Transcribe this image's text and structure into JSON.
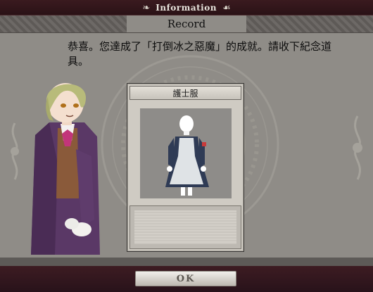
{
  "window": {
    "title": "Information",
    "subtitle": "Record"
  },
  "message": {
    "text": "恭喜。您達成了「打倒冰之惡魔」的成就。請收下紀念道具。"
  },
  "item_card": {
    "name": "護士服"
  },
  "buttons": {
    "ok_label": "OK"
  },
  "icons": {
    "title_left": "scroll-ornament-icon",
    "title_right": "scroll-ornament-icon"
  },
  "colors": {
    "frame": "#2a1216",
    "panel": "#8f8c87",
    "card": "#cfcbc3"
  }
}
